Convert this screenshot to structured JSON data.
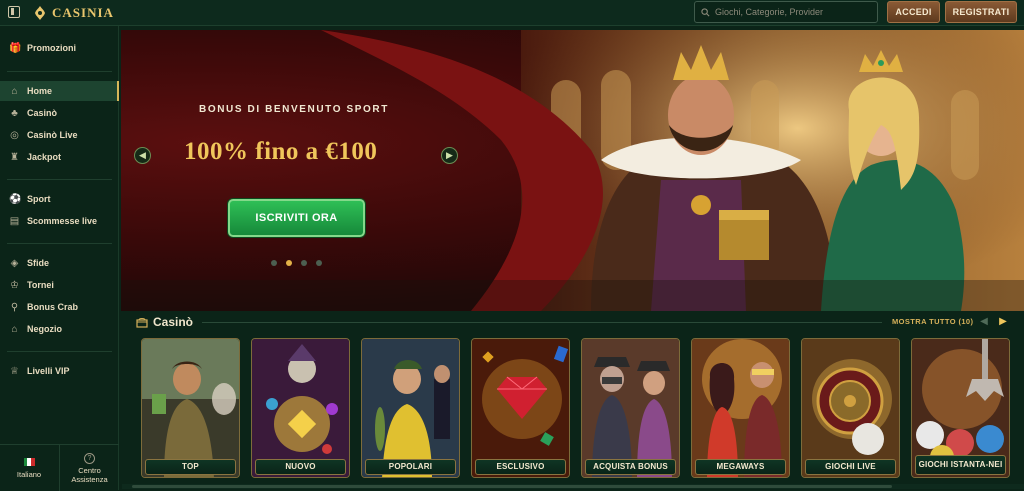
{
  "header": {
    "logo_text": "CASINIA",
    "search_placeholder": "Giochi, Categorie, Provider",
    "login_label": "ACCEDI",
    "register_label": "REGISTRATI"
  },
  "sidebar": {
    "items": [
      {
        "label": "Promozioni",
        "icon": "gift-icon"
      },
      {
        "label": "Home",
        "icon": "home-icon"
      },
      {
        "label": "Casinò",
        "icon": "cherries-icon"
      },
      {
        "label": "Casinò Live",
        "icon": "roulette-icon"
      },
      {
        "label": "Jackpot",
        "icon": "jackpot-icon"
      },
      {
        "label": "Sport",
        "icon": "football-icon"
      },
      {
        "label": "Scommesse live",
        "icon": "live-bet-icon"
      },
      {
        "label": "Sfide",
        "icon": "challenge-icon"
      },
      {
        "label": "Tornei",
        "icon": "trophy-icon"
      },
      {
        "label": "Bonus Crab",
        "icon": "claw-icon"
      },
      {
        "label": "Negozio",
        "icon": "shop-icon"
      },
      {
        "label": "Livelli VIP",
        "icon": "crown-icon"
      }
    ],
    "active": "Home",
    "language_label": "Italiano",
    "help_label": "Centro Assistenza"
  },
  "hero": {
    "subtitle": "BONUS DI BENVENUTO SPORT",
    "title": "100% fino a €100",
    "cta_label": "ISCRIVITI ORA",
    "slide_count": 4,
    "active_slide": 2
  },
  "casino_section": {
    "title": "Casinò",
    "show_all_label": "MOSTRA TUTTO (10)",
    "cards": [
      {
        "label": "TOP"
      },
      {
        "label": "NUOVO"
      },
      {
        "label": "POPOLARI"
      },
      {
        "label": "ESCLUSIVO"
      },
      {
        "label": "ACQUISTA BONUS"
      },
      {
        "label": "MEGAWAYS"
      },
      {
        "label": "GIOCHI LIVE"
      },
      {
        "label": "GIOCHI ISTANTA-NEI"
      }
    ]
  },
  "colors": {
    "accent_gold": "#f0c65b",
    "cta_green": "#1fa648",
    "background": "#0b2418"
  }
}
